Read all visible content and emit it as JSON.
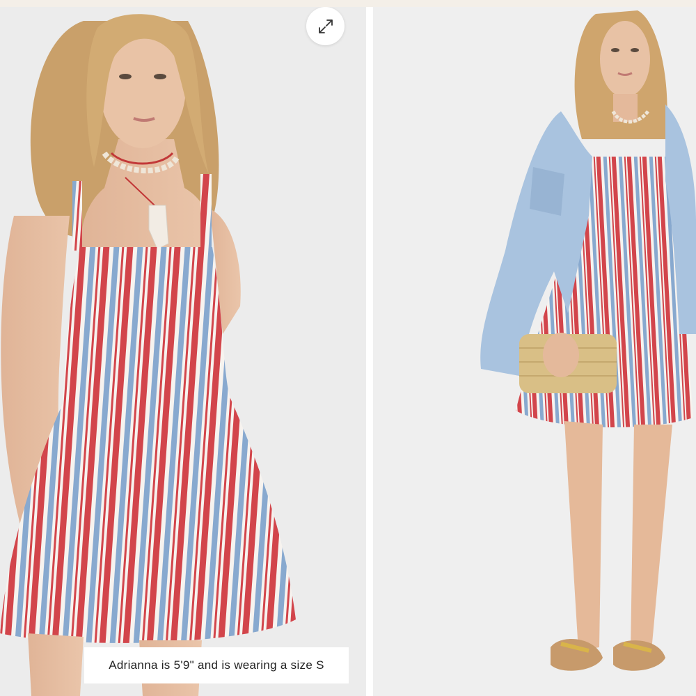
{
  "gallery": {
    "images": [
      {
        "icon": "product-photo-front-closeup"
      },
      {
        "icon": "product-photo-full-length-with-jacket"
      }
    ],
    "expand_icon": "expand-arrows-icon",
    "caption": "Adrianna is 5'9\" and is wearing a size S"
  },
  "colors": {
    "stripe_red": "#d2454b",
    "stripe_blue": "#88a9cf",
    "stripe_white": "#f7f3ef",
    "denim": "#a9c3df",
    "background": "#ececec"
  }
}
